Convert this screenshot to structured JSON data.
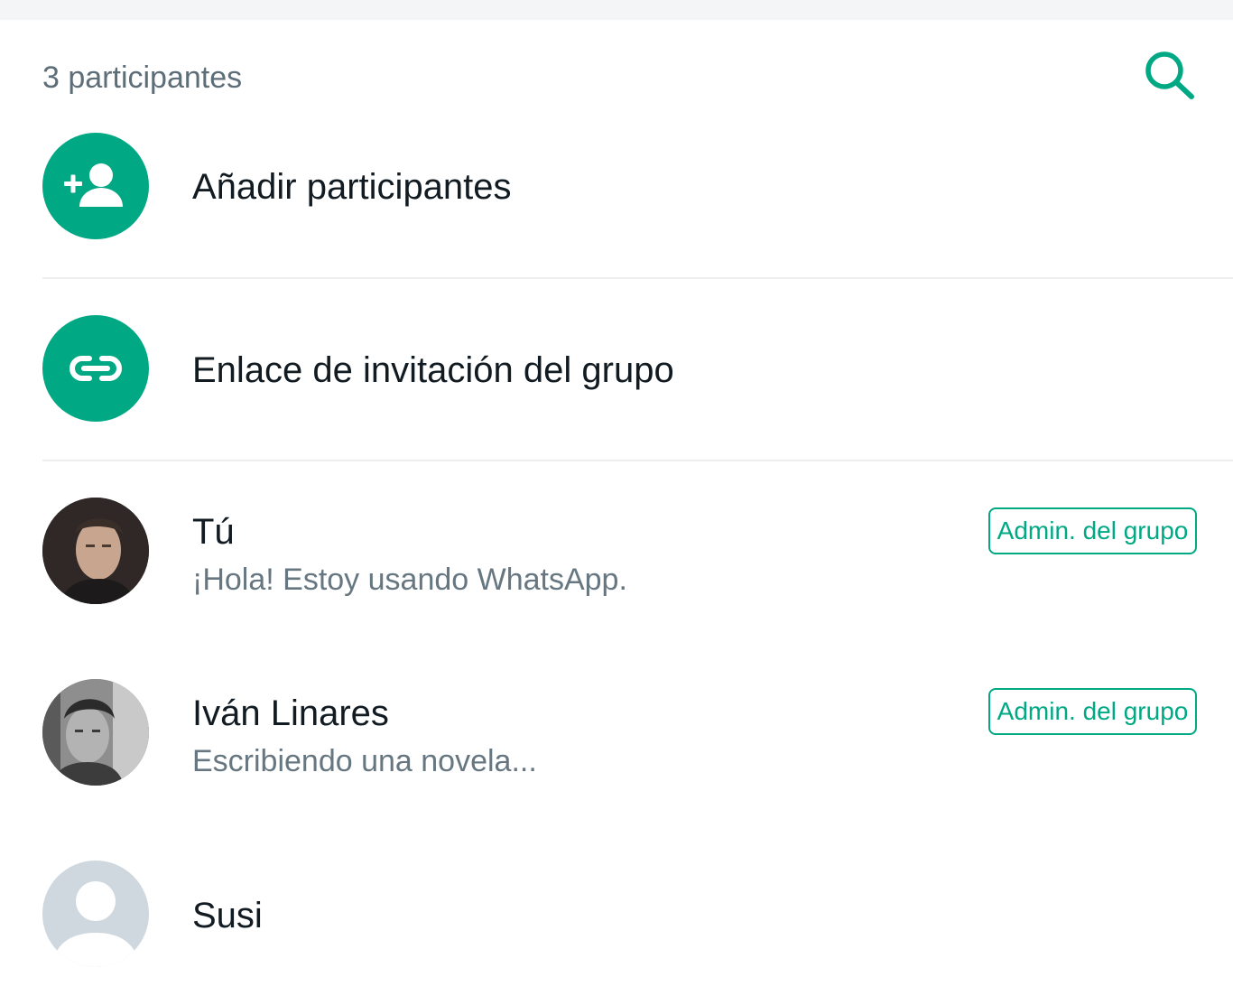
{
  "header": {
    "participant_count_label": "3 participantes",
    "search_icon": "search-icon"
  },
  "actions": [
    {
      "label": "Añadir participantes",
      "icon": "add-person-icon"
    },
    {
      "label": "Enlace de invitación del grupo",
      "icon": "link-icon"
    }
  ],
  "participants": [
    {
      "name": "Tú",
      "status": "¡Hola! Estoy usando WhatsApp.",
      "badge": "Admin. del grupo",
      "avatar": "user-photo"
    },
    {
      "name": "Iván Linares",
      "status": "Escribiendo una novela...",
      "badge": "Admin. del grupo",
      "avatar": "user-photo-bw"
    },
    {
      "name": "Susi",
      "avatar": "default-avatar-icon"
    }
  ],
  "colors": {
    "accent": "#00a884",
    "primary_text": "#111b21",
    "secondary_text": "#667781",
    "header_text": "#5e6e78",
    "default_avatar_bg": "#cfd8de"
  }
}
